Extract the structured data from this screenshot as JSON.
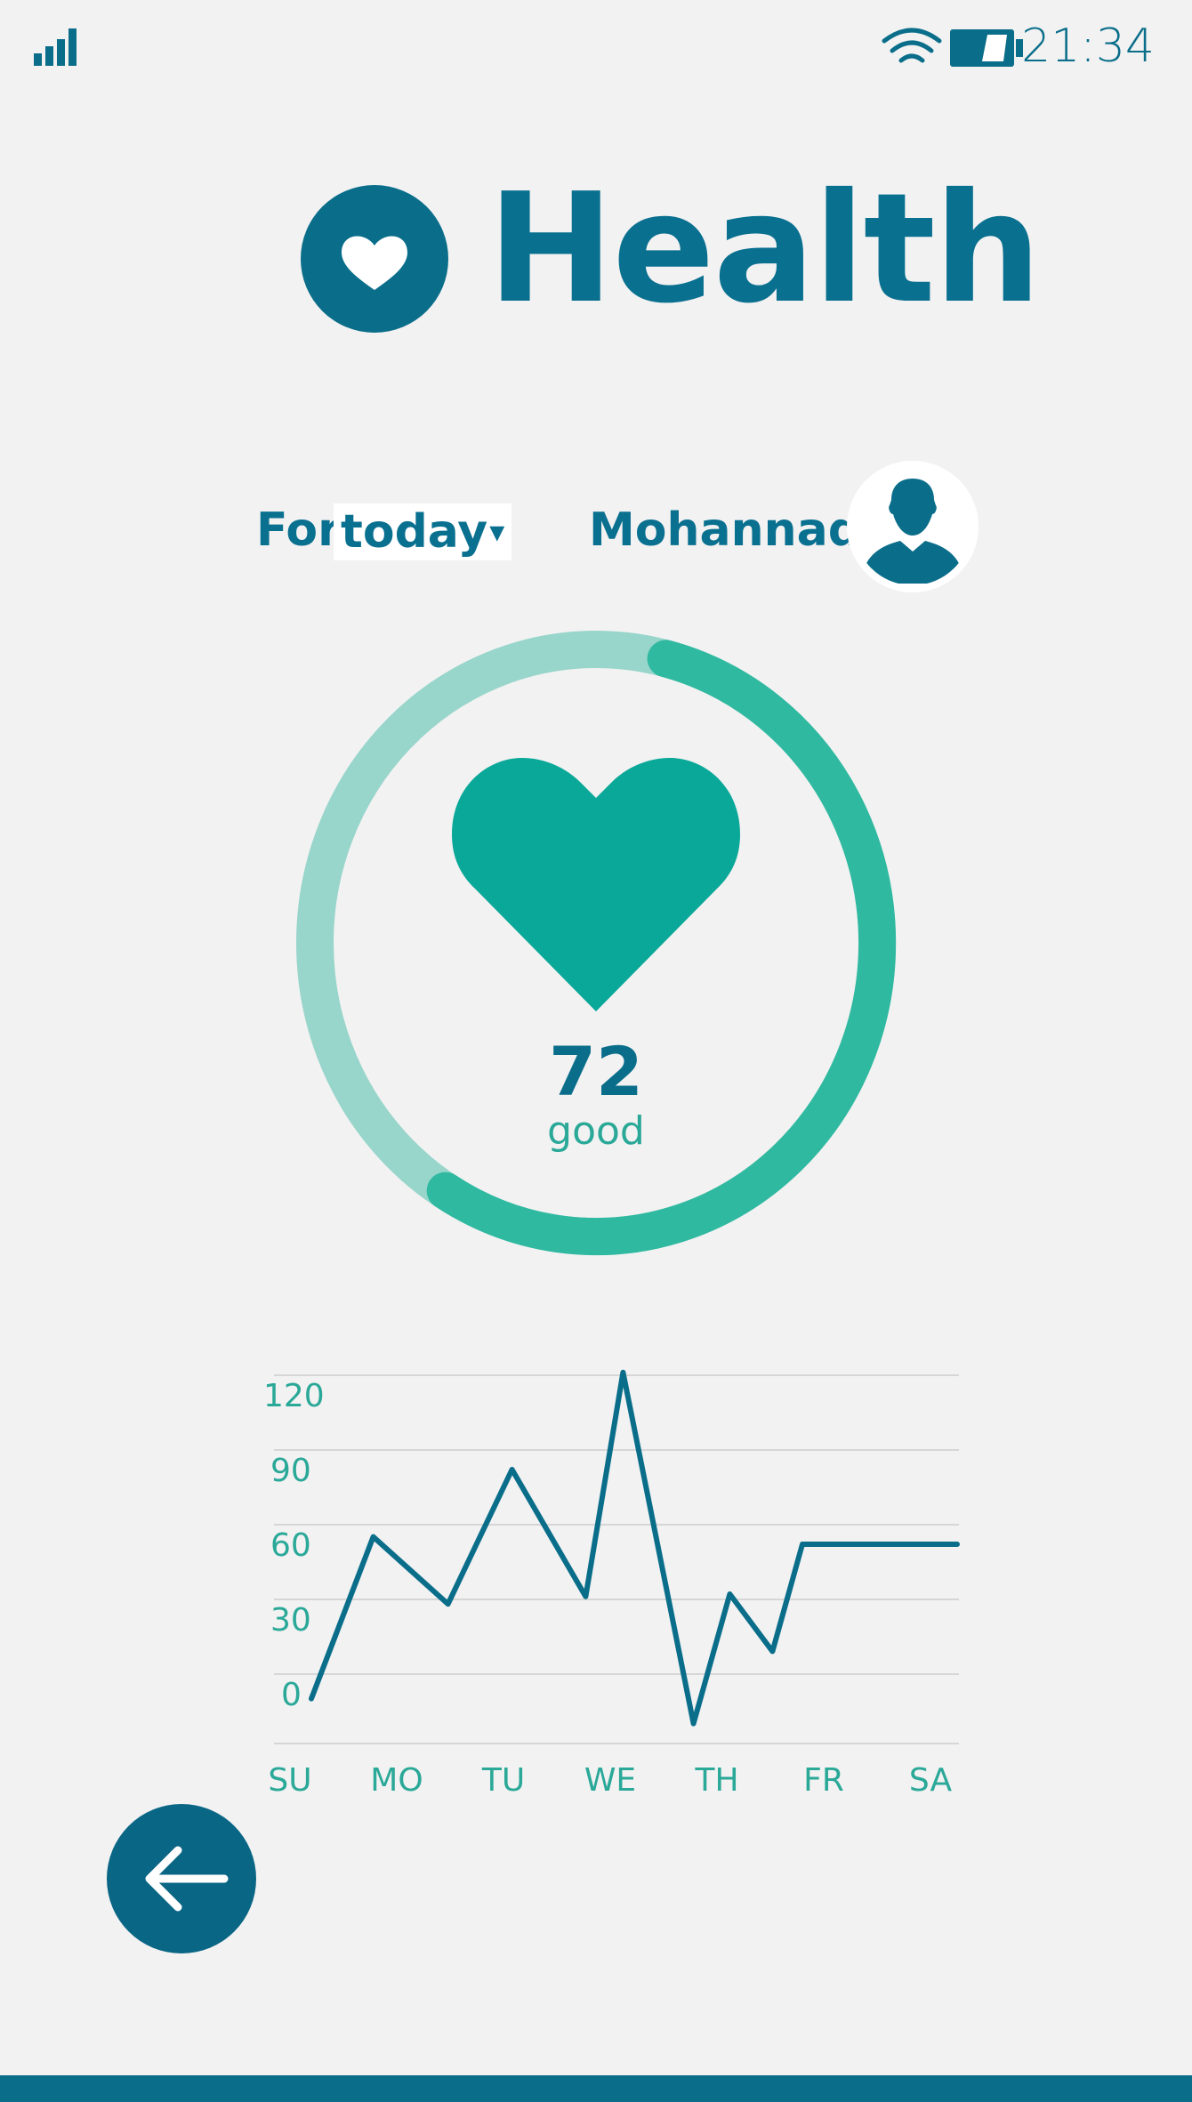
{
  "status_bar": {
    "time": "21:34",
    "icons": [
      "signal-icon",
      "wifi-icon",
      "battery-icon"
    ]
  },
  "header": {
    "title": "Health",
    "logo_icon": "heart-icon"
  },
  "filter": {
    "prefix": "For",
    "period": "today",
    "period_caret": "▾",
    "user_name": "Mohannad",
    "avatar_icon": "user-avatar-icon"
  },
  "heart_rate": {
    "value": "72",
    "status": "good",
    "progress_fraction": 0.55
  },
  "colors": {
    "primary": "#0a7090",
    "accent": "#0aa898",
    "ring_light": "#98d5cb",
    "ring_dark": "#2fb9a0",
    "background": "#f2f2f2"
  },
  "chart_data": {
    "type": "line",
    "categories": [
      "SU",
      "MO",
      "TU",
      "WE",
      "TH",
      "FR",
      "SA"
    ],
    "y_ticks": [
      "120",
      "90",
      "60",
      "30",
      "0"
    ],
    "ylim": [
      -15,
      135
    ],
    "grid": true,
    "series": [
      {
        "points": [
          [
            0.2,
            3
          ],
          [
            0.78,
            68
          ],
          [
            1.48,
            41
          ],
          [
            2.08,
            95
          ],
          [
            2.77,
            44
          ],
          [
            3.12,
            134
          ],
          [
            3.78,
            -7
          ],
          [
            4.12,
            45
          ],
          [
            4.52,
            22
          ],
          [
            4.8,
            65
          ],
          [
            6.25,
            65
          ]
        ]
      }
    ]
  },
  "nav": {
    "back_icon": "arrow-left-icon"
  }
}
